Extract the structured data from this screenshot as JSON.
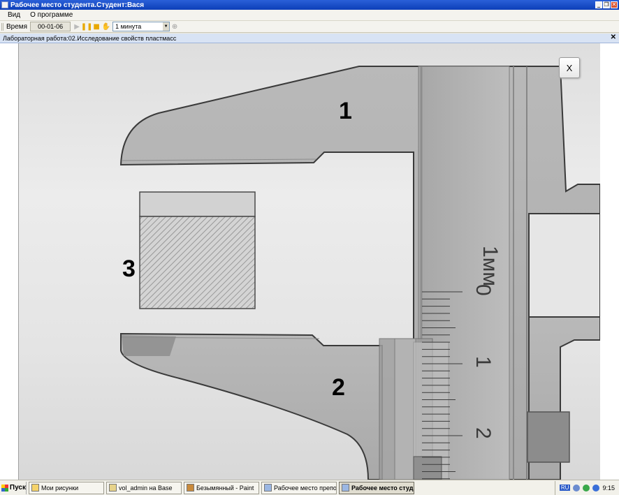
{
  "window": {
    "title": "Рабочее место студента.Студент:Вася",
    "minimize": "_",
    "restore": "❐",
    "close": "✕"
  },
  "menu": {
    "view": "Вид",
    "about": "О программе"
  },
  "toolbar": {
    "time_label": "Время",
    "time_value": "00-01-06",
    "interval": "1 минута"
  },
  "document": {
    "tab_title": "Лабораторная работа:02.Исследование свойств пластмасс",
    "close_glyph": "✕"
  },
  "stage": {
    "close_button": "X",
    "callouts": {
      "upper_jaw": "1",
      "lower_jaw": "2",
      "sample": "3"
    },
    "scale": {
      "unit_label": "1мм",
      "major_ticks": [
        "0",
        "1",
        "2"
      ]
    }
  },
  "taskbar": {
    "start": "Пуск",
    "tasks": [
      {
        "label": "Мои рисунки",
        "active": false
      },
      {
        "label": "vol_admin на Base",
        "active": false
      },
      {
        "label": "Безымянный - Paint",
        "active": false
      },
      {
        "label": "Рабочее место препода...",
        "active": false
      },
      {
        "label": "Рабочее место студ...",
        "active": true
      }
    ],
    "lang": "RU",
    "clock": "9:15"
  }
}
